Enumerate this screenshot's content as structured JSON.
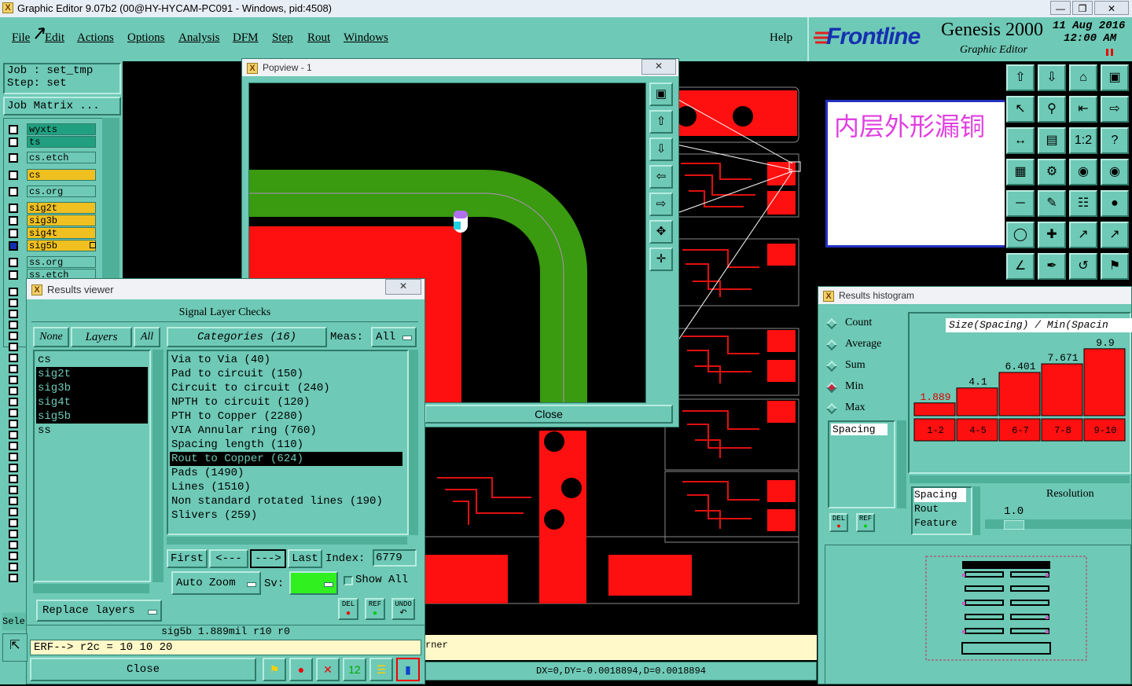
{
  "window": {
    "title": "Graphic Editor 9.07b2 (00@HY-HYCAM-PC091 - Windows, pid:4508)"
  },
  "menu": {
    "items": [
      "File",
      "Edit",
      "Actions",
      "Options",
      "Analysis",
      "DFM",
      "Step",
      "Rout",
      "Windows"
    ],
    "help": "Help"
  },
  "brand": {
    "logo": "Frontline",
    "product": "Genesis 2000",
    "subtitle": "Graphic Editor",
    "date": "11 Aug 2016",
    "time": "12:00 AM"
  },
  "job": {
    "job_label": "Job  : set_tmp",
    "step_label": "Step: set",
    "matrix_button": "Job Matrix ..."
  },
  "layers": [
    {
      "name": "wyxts",
      "color": "#20a080"
    },
    {
      "name": "ts",
      "color": "#20a080"
    },
    {
      "name": "cs.etch",
      "color": "#6ec9b6"
    },
    {
      "name": "cs",
      "color": "#f0c020"
    },
    {
      "name": "cs.org",
      "color": "#6ec9b6"
    },
    {
      "name": "sig2t",
      "color": "#f0c020"
    },
    {
      "name": "sig3b",
      "color": "#f0c020"
    },
    {
      "name": "sig4t",
      "color": "#f0c020"
    },
    {
      "name": "sig5b",
      "color": "#f0c020"
    },
    {
      "name": "ss.org",
      "color": "#6ec9b6"
    },
    {
      "name": "ss.etch",
      "color": "#6ec9b6"
    }
  ],
  "popview": {
    "title": "Popview - 1",
    "close_label": "Close"
  },
  "note": {
    "text": "内层外形漏铜"
  },
  "results_viewer": {
    "title": "Results viewer",
    "header": "Signal Layer Checks",
    "none_label": "None",
    "layers_label": "Layers",
    "all_label": "All",
    "categories_label": "Categories (16)",
    "meas_label": "Meas:",
    "meas_value": "All",
    "layers": [
      {
        "name": "cs",
        "selected": false
      },
      {
        "name": "sig2t",
        "selected": true
      },
      {
        "name": "sig3b",
        "selected": true
      },
      {
        "name": "sig4t",
        "selected": true
      },
      {
        "name": "sig5b",
        "selected": true
      },
      {
        "name": "ss",
        "selected": false
      }
    ],
    "categories": [
      {
        "name": "Via to Via (40)",
        "selected": false
      },
      {
        "name": "Pad to circuit (150)",
        "selected": false
      },
      {
        "name": "Circuit to circuit (240)",
        "selected": false
      },
      {
        "name": "NPTH to circuit (120)",
        "selected": false
      },
      {
        "name": "PTH to Copper (2280)",
        "selected": false
      },
      {
        "name": "VIA Annular ring (760)",
        "selected": false
      },
      {
        "name": "Spacing length (110)",
        "selected": false
      },
      {
        "name": "Rout to Copper (624)",
        "selected": true
      },
      {
        "name": "Pads (1490)",
        "selected": false
      },
      {
        "name": "Lines (1510)",
        "selected": false
      },
      {
        "name": "Non standard rotated lines (190)",
        "selected": false
      },
      {
        "name": "Slivers (259)",
        "selected": false
      }
    ],
    "first_label": "First",
    "prev_label": "<---",
    "next_label": "--->",
    "last_label": "Last",
    "index_label": "Index:",
    "index_value": "6779",
    "auto_zoom_label": "Auto Zoom",
    "sv_label": "Sv:",
    "show_all_label": "Show All",
    "replace_layers_label": "Replace layers",
    "del_label": "DEL",
    "ref_label": "REF",
    "undo_label": "UNDO",
    "status_line": "sig5b 1.889mil   r10   r0",
    "erf_line": "ERF--> r2c = 10 10 20",
    "close_label": "Close"
  },
  "status": {
    "partial_left": "Sele",
    "partial_mid": "rner",
    "coords": "DX=0,DY=-0.0018894,D=0.0018894"
  },
  "histogram": {
    "title": "Results histogram",
    "options": [
      {
        "label": "Count",
        "selected": false
      },
      {
        "label": "Average",
        "selected": false
      },
      {
        "label": "Sum",
        "selected": false
      },
      {
        "label": "Min",
        "selected": true
      },
      {
        "label": "Max",
        "selected": false
      }
    ],
    "list_header": "Spacing",
    "chart_title": "Size(Spacing) / Min(Spacin",
    "buckets": [
      "1-2",
      "4-5",
      "6-7",
      "7-8",
      "9-10"
    ],
    "bar_values": [
      1.889,
      4.1,
      6.401,
      7.671,
      9.9
    ],
    "value_labels": [
      "1.889",
      "4.1",
      "6.401",
      "7.671",
      "9.9"
    ],
    "attr_items": [
      "Spacing",
      "Rout",
      "Feature"
    ],
    "resolution_label": "Resolution",
    "resolution_value": "1.0",
    "del_label": "DEL",
    "ref_label": "REF"
  }
}
